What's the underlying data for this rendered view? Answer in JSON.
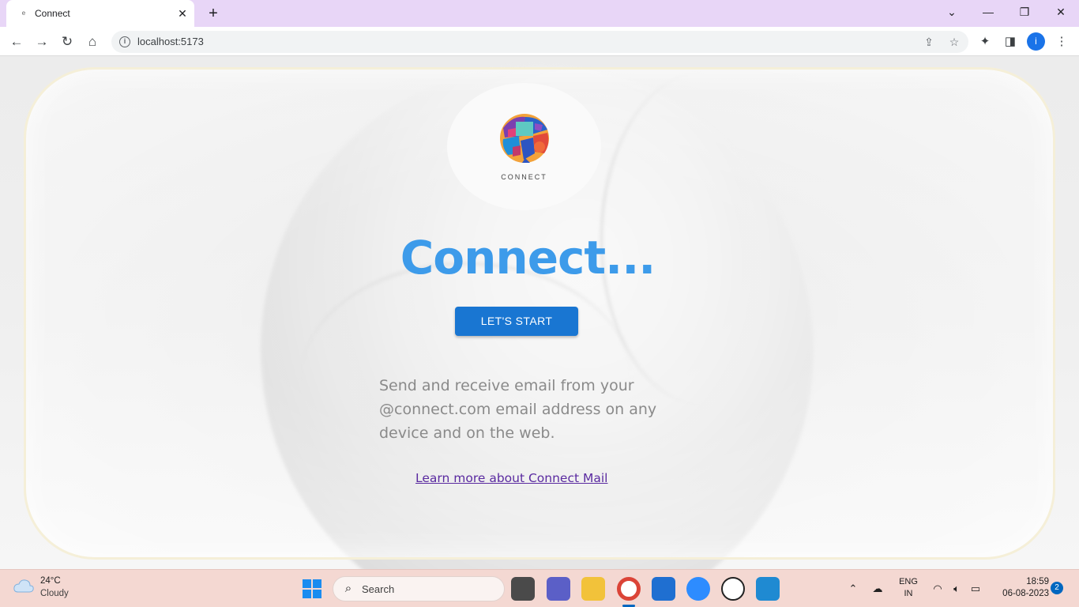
{
  "browser": {
    "tab_title": "Connect",
    "favicon": "e",
    "new_tab_symbol": "+",
    "close_symbol": "✕",
    "url": "localhost:5173",
    "profile_initial": "i"
  },
  "page": {
    "logo_text": "CONNECT",
    "heading": "Connect...",
    "start_button": "LET'S START",
    "description": "Send and receive email from your @connect.com email address on any device and on the web.",
    "learn_more_link": "Learn more about Connect Mail",
    "colors": {
      "heading": "#3d9bea",
      "button": "#1976d2",
      "link": "#5a2aa0",
      "card_border": "#f5efd8"
    }
  },
  "taskbar": {
    "weather_temp": "24°C",
    "weather_condition": "Cloudy",
    "search_placeholder": "Search",
    "language_line1": "ENG",
    "language_line2": "IN",
    "time": "18:59",
    "date": "06-08-2023",
    "notification_count": "2",
    "apps": [
      "task-view",
      "teams-chat",
      "file-explorer",
      "chrome",
      "microsoft-store",
      "zoom",
      "dell",
      "vscode"
    ]
  }
}
